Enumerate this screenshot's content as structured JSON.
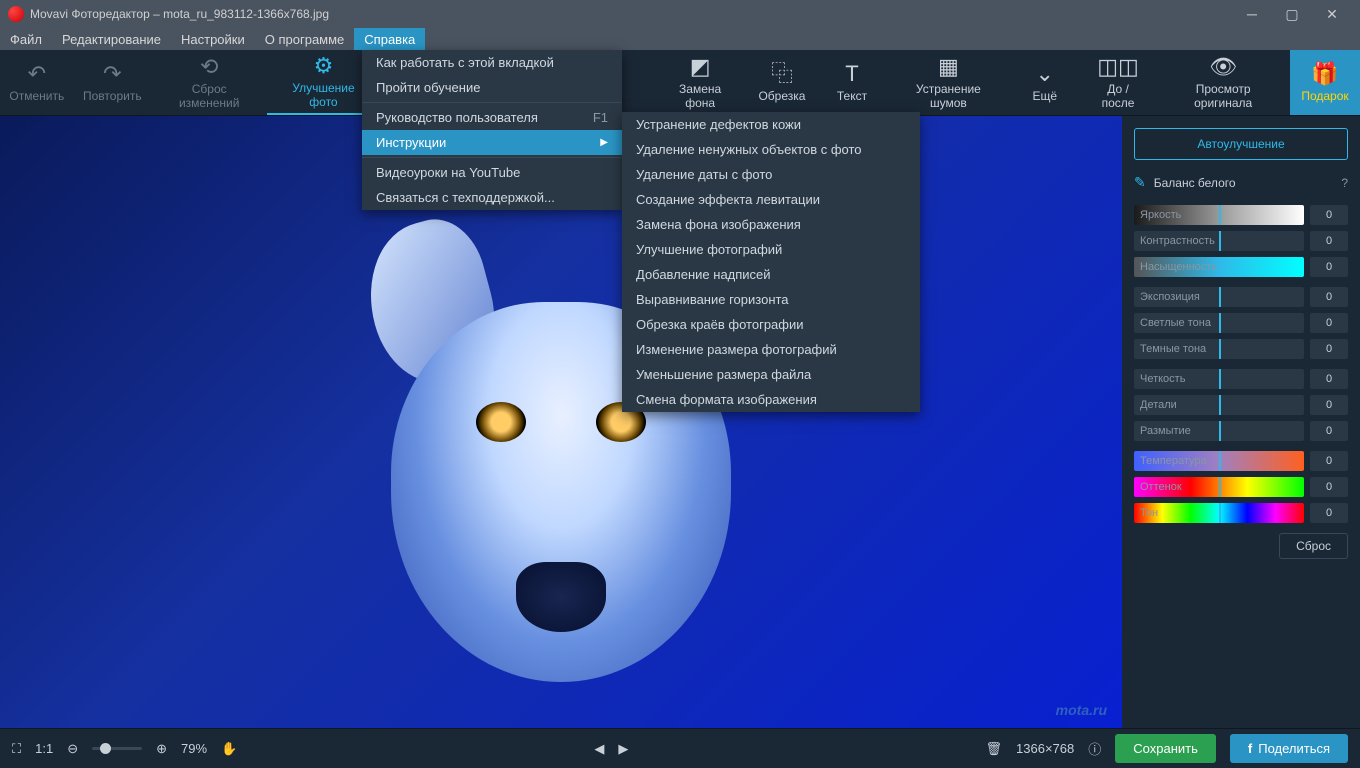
{
  "title": "Movavi Фоторедактор – mota_ru_983112-1366x768.jpg",
  "menu": {
    "file": "Файл",
    "edit": "Редактирование",
    "settings": "Настройки",
    "about": "О программе",
    "help": "Справка"
  },
  "tools": {
    "undo": "Отменить",
    "redo": "Повторить",
    "reset": "Сброс изменений",
    "enhance": "Улучшение фото",
    "replace_bg": "Замена фона",
    "crop": "Обрезка",
    "text": "Текст",
    "denoise": "Устранение шумов",
    "more": "Ещё",
    "before_after": "До / после",
    "view_original": "Просмотр оригинала",
    "gift": "Подарок"
  },
  "dropdown1": {
    "howto": "Как работать с этой вкладкой",
    "tutorial": "Пройти обучение",
    "manual": "Руководство пользователя",
    "manual_key": "F1",
    "instructions": "Инструкции",
    "youtube": "Видеоуроки на YouTube",
    "support": "Связаться с техподдержкой..."
  },
  "dropdown2": [
    "Устранение дефектов кожи",
    "Удаление ненужных объектов с фото",
    "Удаление даты с фото",
    "Создание эффекта левитации",
    "Замена фона изображения",
    "Улучшение фотографий",
    "Добавление надписей",
    "Выравнивание горизонта",
    "Обрезка краёв фотографии",
    "Изменение размера фотографий",
    "Уменьшение размера файла",
    "Смена формата изображения"
  ],
  "sidebar": {
    "auto": "Автоулучшение",
    "wb": "Баланс белого",
    "sliders1": [
      {
        "l": "Яркость",
        "v": "0"
      },
      {
        "l": "Контрастность",
        "v": "0"
      },
      {
        "l": "Насыщенность",
        "v": "0"
      }
    ],
    "sliders2": [
      {
        "l": "Экспозиция",
        "v": "0"
      },
      {
        "l": "Светлые тона",
        "v": "0"
      },
      {
        "l": "Темные тона",
        "v": "0"
      }
    ],
    "sliders3": [
      {
        "l": "Четкость",
        "v": "0"
      },
      {
        "l": "Детали",
        "v": "0"
      },
      {
        "l": "Размытие",
        "v": "0"
      }
    ],
    "sliders4": [
      {
        "l": "Температура",
        "v": "0"
      },
      {
        "l": "Оттенок",
        "v": "0"
      },
      {
        "l": "Тон",
        "v": "0"
      }
    ],
    "reset": "Сброс"
  },
  "status": {
    "one": "1:1",
    "zoom": "79%",
    "dims": "1366×768",
    "save": "Сохранить",
    "share": "Поделиться"
  },
  "watermark": "mota.ru"
}
